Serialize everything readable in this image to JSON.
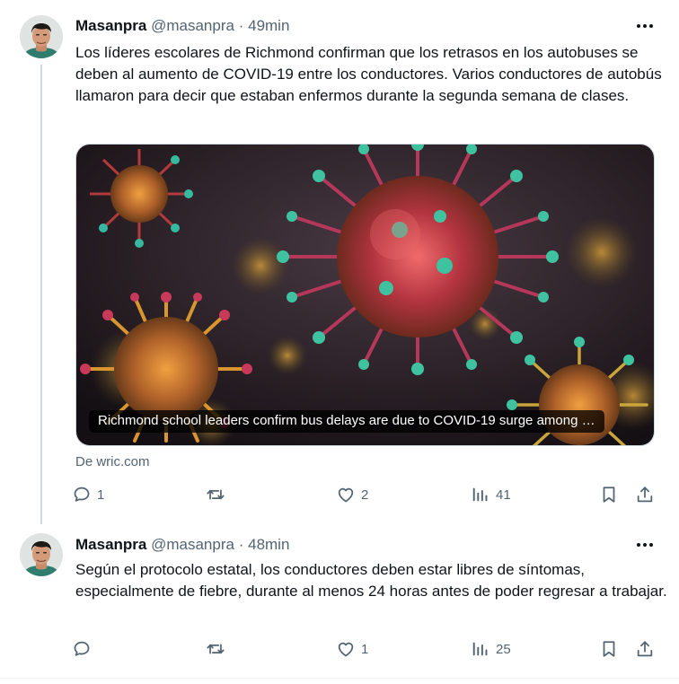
{
  "tweets": [
    {
      "author": {
        "name": "Masanpra",
        "handle": "@masanpra"
      },
      "separator": "·",
      "time": "49min",
      "text": "Los líderes escolares de Richmond confirman que los retrasos en los autobuses se deben al aumento de COVID-19 entre los conductores. Varios conductores de autobús llamaron para decir que estaban enfermos durante la segunda semana de clases.",
      "card": {
        "image": "coronavirus-particles-illustration",
        "caption": "Richmond school leaders confirm bus delays are due to COVID-19 surge among …",
        "source": "De wric.com"
      },
      "stats": {
        "replies": "1",
        "retweets": "",
        "likes": "2",
        "views": "41"
      }
    },
    {
      "author": {
        "name": "Masanpra",
        "handle": "@masanpra"
      },
      "separator": "·",
      "time": "48min",
      "text": "Según el protocolo estatal, los conductores deben estar libres de síntomas, especialmente de fiebre, durante al menos 24 horas antes de poder regresar a trabajar.",
      "stats": {
        "replies": "",
        "retweets": "",
        "likes": "1",
        "views": "25"
      }
    }
  ],
  "colors": {
    "text": "#0f1419",
    "secondary": "#536471",
    "line": "#cfd9de",
    "background": "#ffffff"
  },
  "icons": [
    "more-icon",
    "reply-icon",
    "retweet-icon",
    "like-icon",
    "views-icon",
    "bookmark-icon",
    "share-icon"
  ]
}
